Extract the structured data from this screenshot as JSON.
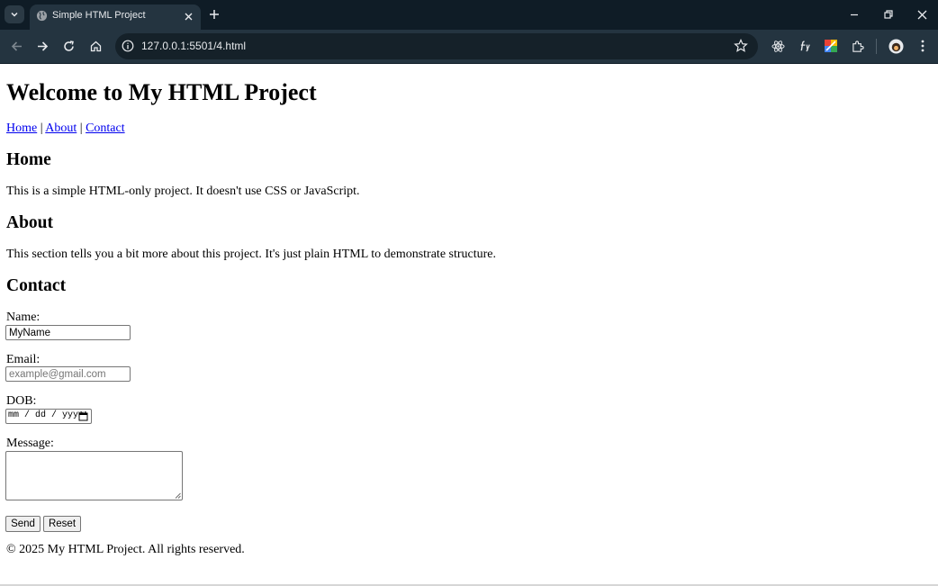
{
  "browser": {
    "tab": {
      "title": "Simple HTML Project"
    },
    "address_bar": {
      "url": "127.0.0.1:5501/4.html"
    }
  },
  "page": {
    "title": "Welcome to My HTML Project",
    "nav": {
      "links": [
        "Home",
        "About",
        "Contact"
      ],
      "separator": "|"
    },
    "sections": [
      {
        "heading": "Home",
        "text": "This is a simple HTML-only project. It doesn't use CSS or JavaScript."
      },
      {
        "heading": "About",
        "text": "This section tells you a bit more about this project. It's just plain HTML to demonstrate structure."
      },
      {
        "heading": "Contact"
      }
    ],
    "form": {
      "name_label": "Name:",
      "name_value": "MyName",
      "email_label": "Email:",
      "email_placeholder": "example@gmail.com",
      "dob_label": "DOB:",
      "dob_placeholder": "mm / dd / yyyy",
      "message_label": "Message:",
      "submit_label": "Send",
      "reset_label": "Reset"
    },
    "footer": "© 2025 My HTML Project. All rights reserved."
  }
}
